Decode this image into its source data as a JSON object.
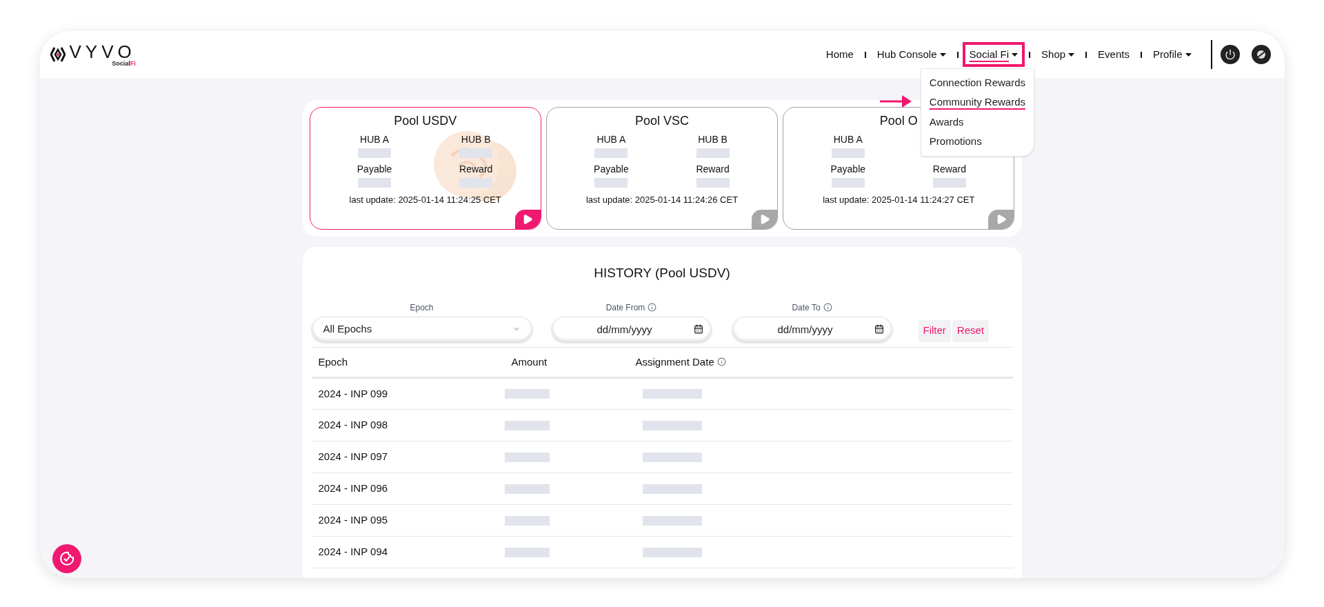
{
  "logo": {
    "wordmark": "VYVO",
    "tagline": "Social",
    "tagline_accent": "Fi"
  },
  "nav": {
    "items": [
      {
        "label": "Home",
        "dropdown": false,
        "highlighted": false
      },
      {
        "label": "Hub Console",
        "dropdown": true,
        "highlighted": false
      },
      {
        "label": "Social Fi",
        "dropdown": true,
        "highlighted": true
      },
      {
        "label": "Shop",
        "dropdown": true,
        "highlighted": false
      },
      {
        "label": "Events",
        "dropdown": false,
        "highlighted": false
      },
      {
        "label": "Profile",
        "dropdown": true,
        "highlighted": false
      }
    ]
  },
  "menu": {
    "items": [
      {
        "label": "Connection Rewards",
        "highlighted": false
      },
      {
        "label": "Community Rewards",
        "highlighted": true
      },
      {
        "label": "Awards",
        "highlighted": false
      },
      {
        "label": "Promotions",
        "highlighted": false
      }
    ]
  },
  "pools": [
    {
      "title": "Pool USDV",
      "selected": true,
      "coin_art": true,
      "rows": [
        {
          "left": {
            "label": "HUB A"
          },
          "right": {
            "label": "HUB B"
          }
        },
        {
          "left": {
            "label": "Payable"
          },
          "right": {
            "label": "Reward"
          }
        }
      ],
      "last_update": "last update: 2025-01-14 11:24:25 CET"
    },
    {
      "title": "Pool VSC",
      "selected": false,
      "coin_art": false,
      "rows": [
        {
          "left": {
            "label": "HUB A"
          },
          "right": {
            "label": "HUB B"
          }
        },
        {
          "left": {
            "label": "Payable"
          },
          "right": {
            "label": "Reward"
          }
        }
      ],
      "last_update": "last update: 2025-01-14 11:24:26 CET"
    },
    {
      "title": "Pool O",
      "selected": false,
      "coin_art": false,
      "rows": [
        {
          "left": {
            "label": "HUB A"
          }
        },
        {
          "left": {
            "label": "Payable"
          },
          "right": {
            "label": "Reward"
          }
        }
      ],
      "last_update": "last update: 2025-01-14 11:24:27 CET"
    }
  ],
  "history": {
    "title": "HISTORY (Pool USDV)",
    "filters": [
      {
        "kind": "select",
        "label": "Epoch",
        "value": "All Epochs",
        "info": false
      },
      {
        "kind": "date",
        "label": "Date From",
        "placeholder": "dd/mm/yyyy",
        "info": true
      },
      {
        "kind": "date",
        "label": "Date To",
        "placeholder": "dd/mm/yyyy",
        "info": true
      }
    ],
    "buttons": [
      "Filter",
      "Reset"
    ],
    "columns": [
      {
        "label": "Epoch",
        "info": false
      },
      {
        "label": "Amount",
        "info": false
      },
      {
        "label": "Assignment Date",
        "info": true
      }
    ],
    "rows": [
      {
        "epoch": "2024 - INP 099"
      },
      {
        "epoch": "2024 - INP 098"
      },
      {
        "epoch": "2024 - INP 097"
      },
      {
        "epoch": "2024 - INP 096"
      },
      {
        "epoch": "2024 - INP 095"
      },
      {
        "epoch": "2024 - INP 094"
      }
    ]
  }
}
